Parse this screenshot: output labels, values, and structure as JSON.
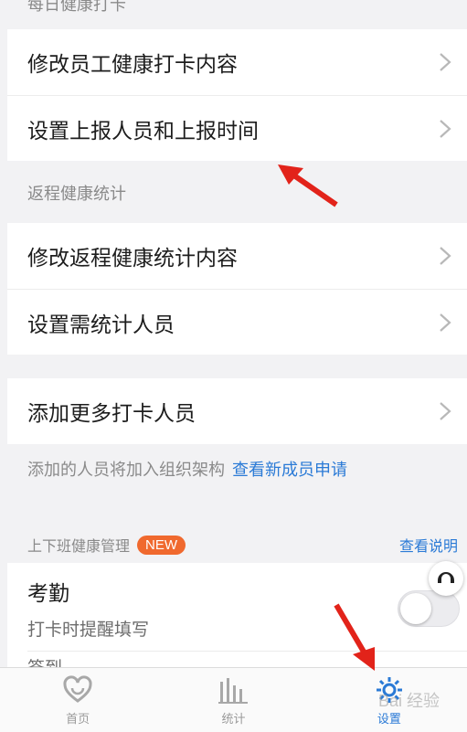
{
  "sections": {
    "daily_header": "每日健康打卡",
    "daily_items": [
      "修改员工健康打卡内容",
      "设置上报人员和上报时间"
    ],
    "return_header": "返程健康统计",
    "return_items": [
      "修改返程健康统计内容",
      "设置需统计人员"
    ],
    "add_item": "添加更多打卡人员",
    "add_note": "添加的人员将加入组织架构",
    "add_note_link": "查看新成员申请"
  },
  "attendance": {
    "header": "上下班健康管理",
    "badge": "NEW",
    "help_link": "查看说明",
    "title": "考勤",
    "subtitle": "打卡时提醒填写",
    "clipped_row": "签到",
    "toggle_on": false
  },
  "tabbar": {
    "tabs": [
      {
        "label": "首页",
        "icon": "heart-icon",
        "active": false
      },
      {
        "label": "统计",
        "icon": "bar-chart-icon",
        "active": false
      },
      {
        "label": "设置",
        "icon": "gear-icon",
        "active": true
      }
    ]
  },
  "colors": {
    "accent": "#2a7ad6",
    "badge": "#f0692e",
    "annotation_arrow": "#e2231a"
  },
  "watermark": "Bai 经验"
}
